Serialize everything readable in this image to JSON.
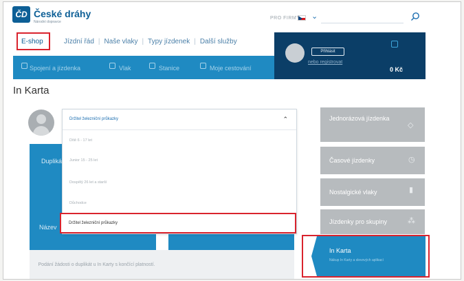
{
  "header": {
    "logo_text": "ČD",
    "brand": "České dráhy",
    "brand_sub": "Národní dopravce",
    "for_business": "PRO FIRMY",
    "search_icon": "search-icon",
    "language_icon": "czech-flag-icon"
  },
  "nav": {
    "items": [
      "E-shop",
      "Jízdní řád",
      "Naše vlaky",
      "Typy jízdenek",
      "Další služby"
    ]
  },
  "toolbar": {
    "items": [
      "Spojení a jízdenka",
      "Vlak",
      "Stanice",
      "Moje cestování"
    ]
  },
  "account": {
    "login_label": "Přihlásit",
    "register_label": "nebo registrovat",
    "cart_total": "0 Kč"
  },
  "page": {
    "title": "In Karta"
  },
  "dropdown": {
    "header": "Držitel železniční průkazky",
    "options": [
      "Dítě 6 - 17 let",
      "Junior 15 - 25 let",
      "Dospělý 26 let a starší",
      "Důchodce"
    ],
    "selected": "Držitel železniční průkazky"
  },
  "cards": {
    "left_title": "Duplikát",
    "left_bottom": "Název",
    "bottom_text": "Podání žádosti o duplikát u In Karty s končící platností."
  },
  "right_menu": {
    "items": [
      {
        "label": "Jednorázová jízdenka",
        "icon": "ticket-icon"
      },
      {
        "label": "Časové jízdenky",
        "icon": "clock-icon"
      },
      {
        "label": "Nostalgické vlaky",
        "icon": "train-icon"
      },
      {
        "label": "Jízdenky pro skupiny",
        "icon": "group-icon"
      }
    ],
    "active": {
      "label": "In Karta",
      "sub": "Nákup In Karty a slevových aplikací"
    }
  },
  "colors": {
    "brand_blue": "#0d5f96",
    "bar_blue": "#1f8ac2",
    "dark_navy": "#0b3e67",
    "highlight_red": "#d9232d",
    "menu_gray": "#b7bbbe"
  }
}
